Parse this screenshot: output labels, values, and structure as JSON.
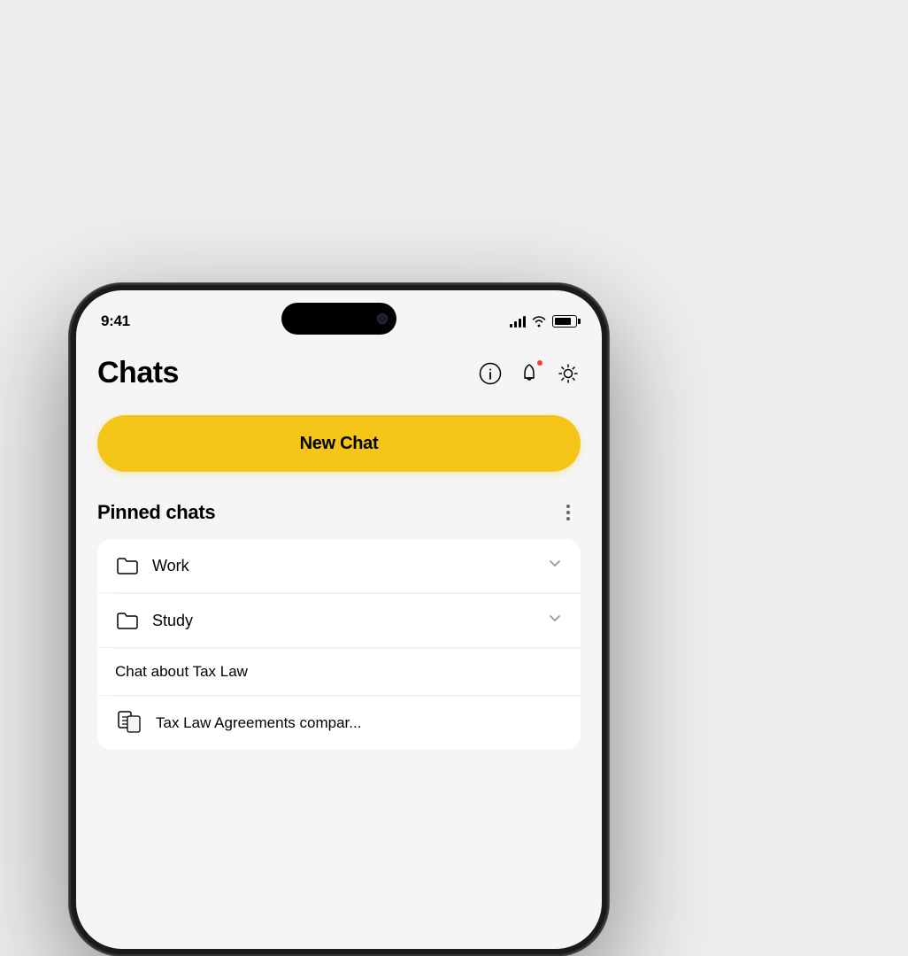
{
  "status_bar": {
    "time": "9:41",
    "signal_label": "signal",
    "wifi_label": "wifi",
    "battery_label": "battery"
  },
  "header": {
    "title": "Chats",
    "info_icon": "info-circle",
    "bell_icon": "bell",
    "brightness_icon": "sun"
  },
  "new_chat_button": {
    "label": "New Chat"
  },
  "pinned_section": {
    "title": "Pinned chats",
    "more_icon": "more-vertical"
  },
  "folders": [
    {
      "name": "Work",
      "has_chevron": true
    },
    {
      "name": "Study",
      "has_chevron": true
    }
  ],
  "chats": [
    {
      "title": "Chat about Tax Law",
      "has_icon": false
    },
    {
      "title": "Tax Law Agreements compar...",
      "has_icon": true
    }
  ]
}
